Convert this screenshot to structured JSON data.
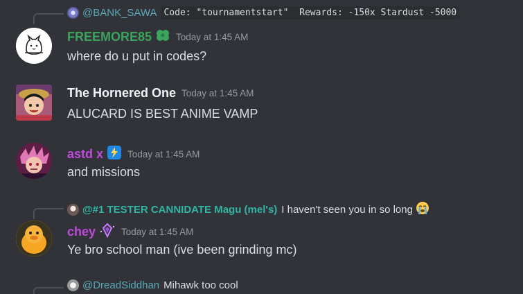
{
  "colors": {
    "background": "#313338",
    "message_text": "#dbdee1",
    "timestamp": "#949ba4",
    "reply_text": "#b5bac1",
    "reply_line": "#4e5058"
  },
  "messages": [
    {
      "reply": {
        "name": "@BANK_SAWA",
        "name_color": "#5aa9b9",
        "avatar_icon": "avatar-bank-sawa",
        "code_text": "Code: \"tournamentstart\"  Rewards: -150x Stardust -5000"
      },
      "author": {
        "name": "FREEMORE85",
        "color": "#3ba55d",
        "badge_icon": "clover-icon"
      },
      "timestamp": "Today at 1:45 AM",
      "content": "where do u put in codes?"
    },
    {
      "author": {
        "name": "The Hornered One",
        "color": "#f2f3f5"
      },
      "timestamp": "Today at 1:45 AM",
      "content": "ALUCARD IS BEST ANIME VAMP"
    },
    {
      "author": {
        "name": "astd x",
        "color": "#c04bdc",
        "badge_icon": "lightning-badge-icon"
      },
      "timestamp": "Today at 1:45 AM",
      "content": "and missions"
    },
    {
      "reply": {
        "name": "@#1 TESTER CANNIDATE Magu (mel's)",
        "name_color": "#2fb6a5",
        "avatar_icon": "avatar-magu",
        "text": "I haven't seen you in so long",
        "emoji_icon": "sob-emoji-icon"
      },
      "author": {
        "name": "chey",
        "color": "#c04bdc",
        "badge_icon": "crystal-badge-icon"
      },
      "timestamp": "Today at 1:45 AM",
      "content": "Ye bro school man (ive been grinding mc)"
    },
    {
      "reply": {
        "name": "@DreadSiddhan",
        "name_color": "#5aa9b9",
        "avatar_icon": "avatar-dread-siddhan",
        "text": "Mihawk too cool"
      }
    }
  ]
}
